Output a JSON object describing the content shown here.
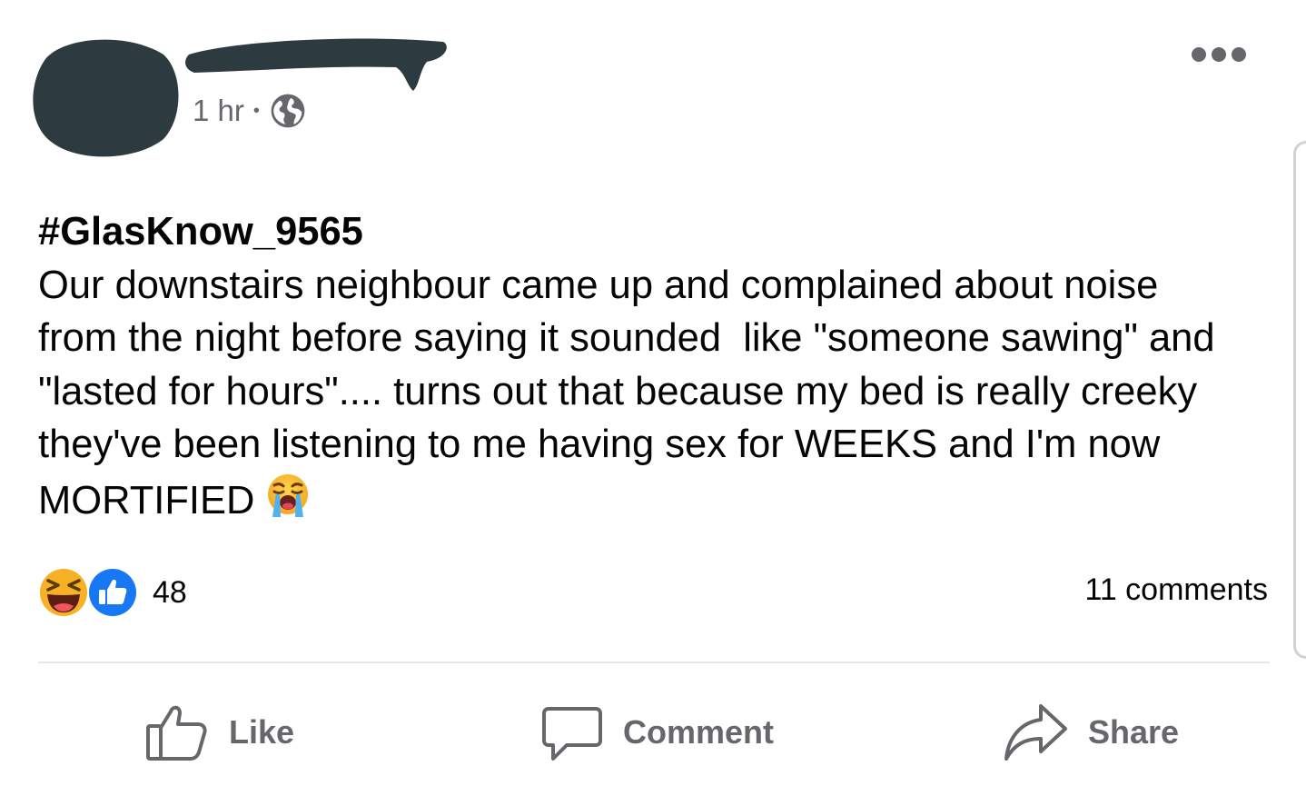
{
  "post": {
    "time": "1 hr",
    "separator": "•",
    "privacy_icon": "globe-icon",
    "more_icon": "more-horizontal-icon",
    "hashtag": "#GlasKnow_9565",
    "lines": [
      "Our downstairs neighbour came up and complained about noise",
      "from the night before saying it sounded  like \"someone sawing\" and",
      "\"lasted for hours\".... turns out that because my bed is really creeky",
      "they've been listening to me having sex for WEEKS and I'm now",
      "MORTIFIED"
    ],
    "trailing_emoji": "loudly-crying-face-icon"
  },
  "reactions": {
    "icons": [
      "haha-reaction-icon",
      "like-reaction-icon"
    ],
    "count": "48",
    "comments": "11 comments"
  },
  "actions": {
    "like": "Like",
    "comment": "Comment",
    "share": "Share"
  },
  "colors": {
    "text": "#050505",
    "secondary": "#65676b",
    "divider": "#e4e6eb",
    "like_blue": "#1877f2",
    "haha_yellow": "#f7b125",
    "redaction": "#2d3a40"
  }
}
